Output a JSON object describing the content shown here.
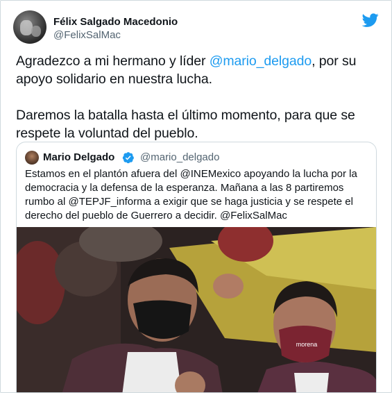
{
  "author": {
    "display_name": "Félix Salgado Macedonio",
    "handle": "@FelixSalMac"
  },
  "tweet": {
    "line1_before": "Agradezco a mi hermano y líder ",
    "line1_mention": "@mario_delgado",
    "line1_after": ", por su apoyo solidario en nuestra lucha.",
    "line2": "Daremos la batalla hasta el último momento, para que se respete la voluntad del pueblo."
  },
  "quoted": {
    "display_name": "Mario Delgado",
    "handle": "@mario_delgado",
    "verified": true,
    "text": "Estamos en el plantón afuera del @INEMexico apoyando la lucha por la democracia y la defensa de la esperanza. Mañana a las 8 partiremos rumbo al @TEPJF_informa a exigir que se haga justicia y se respete el derecho del pueblo de Guerrero a decidir. @FelixSalMac",
    "mask_text": "morena"
  },
  "icons": {
    "brand": "twitter-bird-icon",
    "verified": "verified-badge-icon"
  },
  "colors": {
    "link": "#1d9bf0",
    "text": "#0f1419",
    "secondary": "#536471",
    "border": "#cfd9de"
  }
}
